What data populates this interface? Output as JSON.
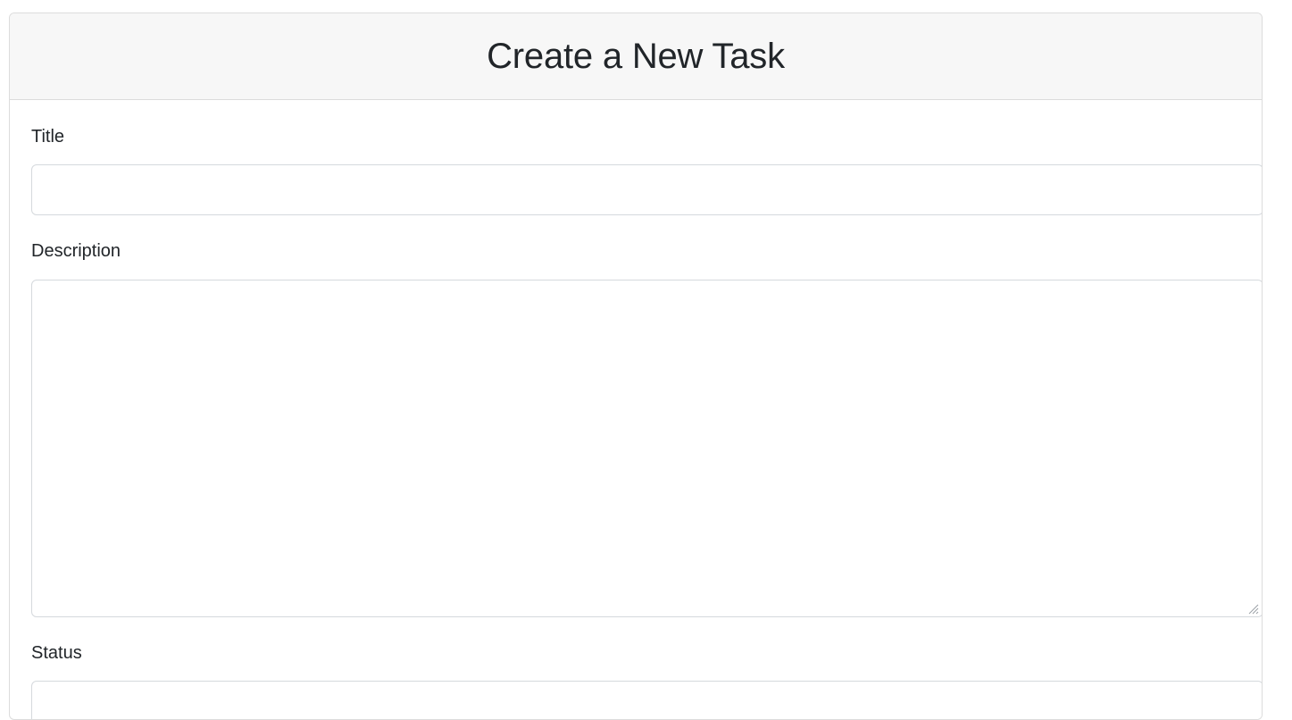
{
  "form": {
    "heading": "Create a New Task",
    "title_label": "Title",
    "title_value": "",
    "description_label": "Description",
    "description_value": "",
    "status_label": "Status"
  }
}
